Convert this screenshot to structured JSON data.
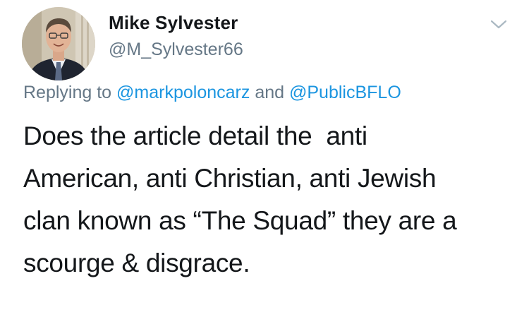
{
  "tweet": {
    "author": {
      "display_name": "Mike Sylvester",
      "handle": "@M_Sylvester66",
      "avatar_icon": "profile-photo"
    },
    "menu_icon": "chevron-down-icon",
    "reply": {
      "prefix": "Replying to",
      "mention_1": "@markpoloncarz",
      "conjunction": "and",
      "mention_2": "@PublicBFLO"
    },
    "text_lines": [
      "Does the article detail the  anti",
      "American, anti Christian, anti Jewish",
      "clan known as “The Squad” they are a",
      "scourge & disgrace."
    ]
  },
  "colors": {
    "text": "#14171a",
    "secondary": "#657786",
    "link": "#1b95e0",
    "chevron": "#aab8c2"
  }
}
